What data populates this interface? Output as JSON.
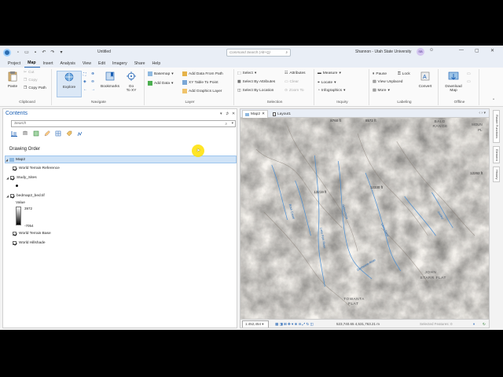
{
  "titlebar": {
    "doc_title": "Untitled",
    "search_placeholder": "Command Search (Alt+Q)",
    "user": "Shannon - Utah State University",
    "avatar_initials": "SB"
  },
  "menu": [
    "Project",
    "Map",
    "Insert",
    "Analysis",
    "View",
    "Edit",
    "Imagery",
    "Share",
    "Help"
  ],
  "ribbon": {
    "clipboard": {
      "label": "Clipboard",
      "paste": "Paste",
      "cut": "Cut",
      "copy": "Copy",
      "copy_path": "Copy Path"
    },
    "navigate": {
      "label": "Navigate",
      "explore": "Explore",
      "bookmarks": "Bookmarks",
      "go_to_xy": "Go\nTo XY"
    },
    "layer": {
      "label": "Layer",
      "basemap": "Basemap",
      "add_data": "Add Data",
      "add_data_from_path": "Add Data From Path",
      "xy_table": "XY Table To Point",
      "add_graphics": "Add Graphics Layer"
    },
    "selection": {
      "label": "Selection",
      "select": "Select",
      "select_by_attr": "Select By Attributes",
      "select_by_loc": "Select By Location",
      "attributes": "Attributes",
      "clear": "Clear",
      "zoom_to": "Zoom To"
    },
    "inquiry": {
      "label": "Inquiry",
      "measure": "Measure",
      "locate": "Locate",
      "infographics": "Infographics"
    },
    "labeling": {
      "label": "Labeling",
      "pause": "Pause",
      "lock": "Lock",
      "view_unplaced": "View Unplaced",
      "more": "More",
      "convert": "Convert"
    },
    "offline": {
      "label": "Offline",
      "download_map": "Download\nMap"
    }
  },
  "contents": {
    "title": "Contents",
    "search_placeholder": "Search",
    "drawing_order": "Drawing Order",
    "map_name": "Map2",
    "layers": [
      "World Terrain Reference",
      "Study_Sites",
      "bedmap2_bed.tif",
      "World Terrain Base",
      "World Hillshade"
    ],
    "legend_value_label": "Value",
    "legend_max": "3972",
    "legend_min": "-7054"
  },
  "map": {
    "tabs": [
      "Map2",
      "Layout1"
    ],
    "scale": "1:452,454",
    "coords": "523,740.65 4,531,763.21 m",
    "selected_features": "Selected Features: 0",
    "labels": {
      "elev1": "8760 ft",
      "elev2": "8572 ft",
      "bald": "BALD",
      "range": "RANGE",
      "mount": "MOUN",
      "pl": "PL",
      "elev3": "12262 ft",
      "elev4": "12330 ft",
      "elev5": "13219 ft",
      "john": "JOHN",
      "starr": "STARR FLAT",
      "towanta": "TOWANTA",
      "flat": "FLAT",
      "river1": "Lake Fork River",
      "river2": "Yellowstone",
      "river3": "Uinta River",
      "river4": "Rock Creek",
      "river5": "Duchesne River",
      "river6": "Ashley"
    }
  },
  "rail": [
    "Raster Functions",
    "Element",
    "History"
  ],
  "colors": {
    "accent": "#1a5fb4",
    "selected_row": "#cfe3f7",
    "highlight": "#ffe100"
  },
  "icons": [
    "app-logo-icon",
    "search-icon",
    "close-icon",
    "pin-icon",
    "checkbox-icon",
    "hillshade-map"
  ]
}
